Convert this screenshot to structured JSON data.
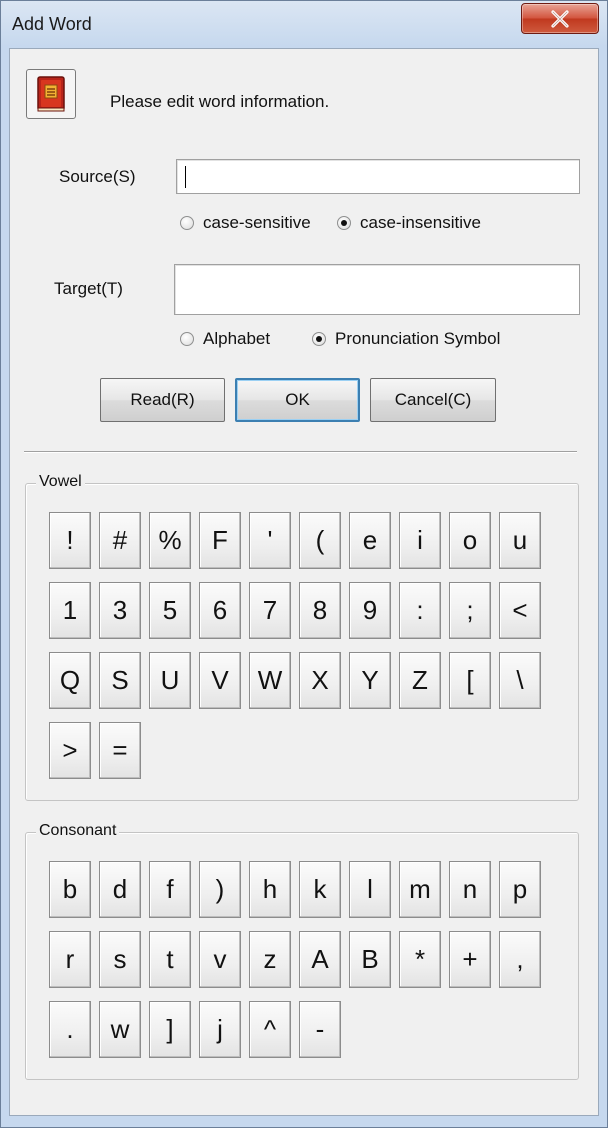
{
  "window": {
    "title": "Add Word",
    "close_glyph": "X",
    "app_icon": "book-icon"
  },
  "dialog": {
    "prompt": "Please edit word information."
  },
  "source": {
    "label": "Source(S)",
    "value": "",
    "options": [
      {
        "label": "case-sensitive",
        "checked": false
      },
      {
        "label": "case-insensitive",
        "checked": true
      }
    ]
  },
  "target": {
    "label": "Target(T)",
    "value": "",
    "options": [
      {
        "label": "Alphabet",
        "checked": false
      },
      {
        "label": "Pronunciation Symbol",
        "checked": true
      }
    ]
  },
  "buttons": {
    "read": "Read(R)",
    "ok": "OK",
    "cancel": "Cancel(C)"
  },
  "vowel": {
    "label": "Vowel",
    "keys": [
      "!",
      "#",
      "%",
      "F",
      "'",
      "(",
      "e",
      "i",
      "o",
      "u",
      "1",
      "3",
      "5",
      "6",
      "7",
      "8",
      "9",
      ":",
      ";",
      "<",
      "Q",
      "S",
      "U",
      "V",
      "W",
      "X",
      "Y",
      "Z",
      "[",
      "\\",
      ">",
      "="
    ]
  },
  "consonant": {
    "label": "Consonant",
    "keys": [
      "b",
      "d",
      "f",
      ")",
      "h",
      "k",
      "l",
      "m",
      "n",
      "p",
      "r",
      "s",
      "t",
      "v",
      "z",
      "A",
      "B",
      "*",
      "+",
      ",",
      ".",
      "w",
      "]",
      "j",
      "^",
      "-"
    ]
  },
  "colors": {
    "titlebar": "#c6d8ee",
    "close_button": "#c0391f",
    "dialog_bg": "#f0f0f0"
  }
}
